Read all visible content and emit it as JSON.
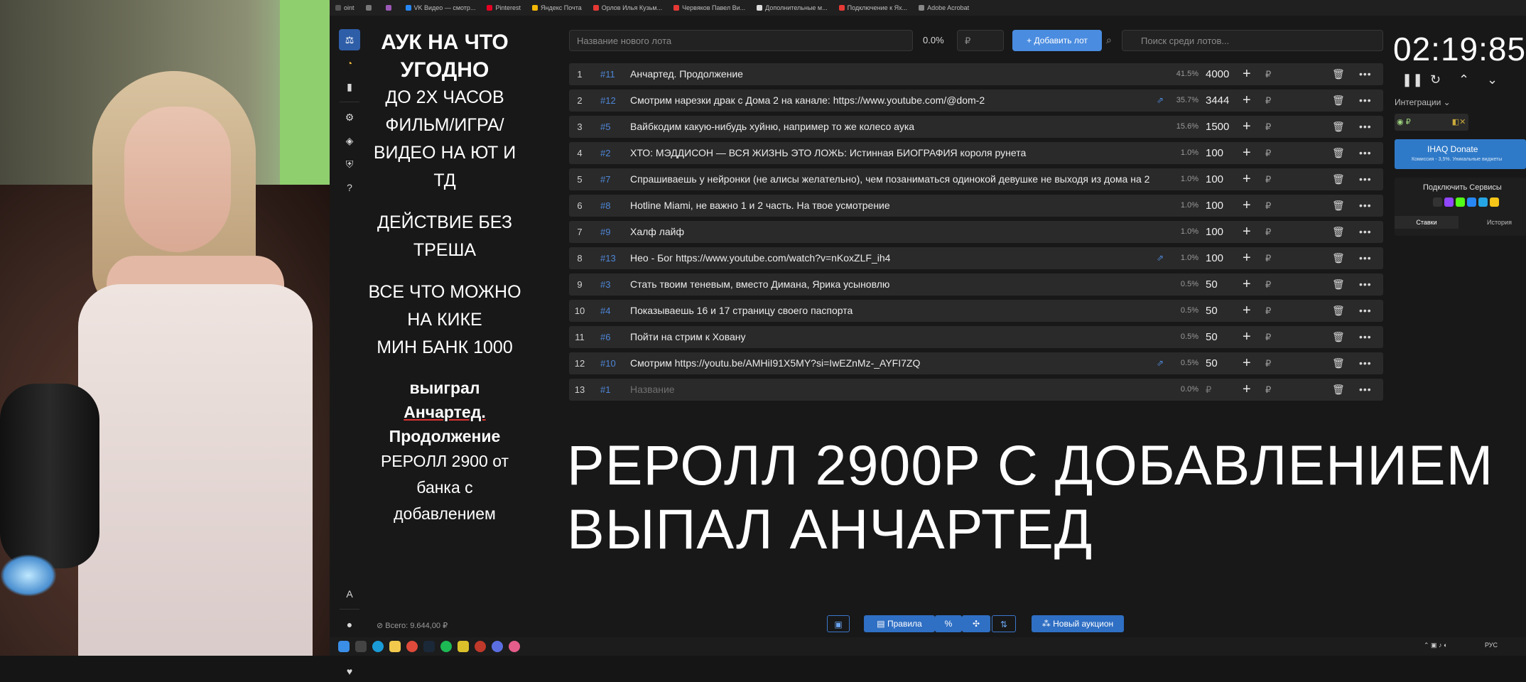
{
  "browser_tabs": [
    {
      "label": "oint",
      "color": "#555555"
    },
    {
      "label": "",
      "color": "#777777"
    },
    {
      "label": "",
      "color": "#9b59b6"
    },
    {
      "label": "VK Видео — смотр...",
      "color": "#2787f5"
    },
    {
      "label": "Pinterest",
      "color": "#e60023"
    },
    {
      "label": "Яндекс Почта",
      "color": "#f2b705"
    },
    {
      "label": "Орлов Илья Кузьм...",
      "color": "#e53935"
    },
    {
      "label": "Червяков Павел Ви...",
      "color": "#e53935"
    },
    {
      "label": "Дополнительные м...",
      "color": "#dddddd"
    },
    {
      "label": "Подключение к Ях...",
      "color": "#e53935"
    },
    {
      "label": "Adobe Acrobat",
      "color": "#888888"
    }
  ],
  "rules": {
    "title": "АУК НА ЧТО УГОДНО",
    "lines1": [
      "ДО 2Х ЧАСОВ",
      "ФИЛЬМ/ИГРА/",
      "ВИДЕО НА ЮТ И ТД"
    ],
    "lines2": [
      "ДЕЙСТВИЕ БЕЗ",
      "ТРЕША"
    ],
    "lines3": [
      "ВСЕ ЧТО МОЖНО",
      "НА КИКЕ",
      "МИН БАНК 1000"
    ],
    "winner_prefix": "выиграл ",
    "winner_name_1": "Анчартед.",
    "winner_name_2": "Продолжение",
    "reroll": [
      "РЕРОЛЛ 2900 от",
      "банка с",
      "добавлением"
    ]
  },
  "toolbar": {
    "new_lot_placeholder": "Название нового лота",
    "percent": "0.0%",
    "amount_placeholder": "₽",
    "add_label": "+ Добавить лот",
    "search_placeholder": "Поиск среди лотов..."
  },
  "lots": [
    {
      "n": "1",
      "id": "#11",
      "name": "Анчартед. Продолжение",
      "link": false,
      "pct": "41.5%",
      "amount": "4000"
    },
    {
      "n": "2",
      "id": "#12",
      "name": "Смотрим нарезки драк с Дома 2 на канале: https://www.youtube.com/@dom-2",
      "link": true,
      "pct": "35.7%",
      "amount": "3444"
    },
    {
      "n": "3",
      "id": "#5",
      "name": "Вайбкодим какую-нибудь хуйню, например то же колесо аука",
      "link": false,
      "pct": "15.6%",
      "amount": "1500"
    },
    {
      "n": "4",
      "id": "#2",
      "name": "ХТО: МЭДДИСОН — ВСЯ ЖИЗНЬ ЭТО ЛОЖЬ: Истинная БИОГРАФИЯ короля рунета",
      "link": false,
      "pct": "1.0%",
      "amount": "100"
    },
    {
      "n": "5",
      "id": "#7",
      "name": "Спрашиваешь у нейронки (не алисы желательно), чем позаниматься одинокой девушке не выходя из дома на 2",
      "link": false,
      "pct": "1.0%",
      "amount": "100"
    },
    {
      "n": "6",
      "id": "#8",
      "name": "Hotline Miami, не важно 1 и 2 часть. На твое усмотрение",
      "link": false,
      "pct": "1.0%",
      "amount": "100"
    },
    {
      "n": "7",
      "id": "#9",
      "name": "Халф лайф",
      "link": false,
      "pct": "1.0%",
      "amount": "100"
    },
    {
      "n": "8",
      "id": "#13",
      "name": "Нео - Бог https://www.youtube.com/watch?v=nKoxZLF_ih4",
      "link": true,
      "pct": "1.0%",
      "amount": "100"
    },
    {
      "n": "9",
      "id": "#3",
      "name": "Стать твоим теневым, вместо Димана, Ярика усыновлю",
      "link": false,
      "pct": "0.5%",
      "amount": "50"
    },
    {
      "n": "10",
      "id": "#4",
      "name": "Показываешь 16 и 17 страницу своего паспорта",
      "link": false,
      "pct": "0.5%",
      "amount": "50"
    },
    {
      "n": "11",
      "id": "#6",
      "name": "Пойти на стрим к Ховану",
      "link": false,
      "pct": "0.5%",
      "amount": "50"
    },
    {
      "n": "12",
      "id": "#10",
      "name": "Смотрим https://youtu.be/AMHiI91X5MY?si=IwEZnMz-_AYFI7ZQ",
      "link": true,
      "pct": "0.5%",
      "amount": "50"
    },
    {
      "n": "13",
      "id": "#1",
      "name": "Название",
      "link": false,
      "pct": "0.0%",
      "amount": "₽",
      "placeholder": true
    }
  ],
  "lot_currency": "₽",
  "overlay": {
    "line1": "РЕРОЛЛ 2900Р С ДОБАВЛЕНИЕМ",
    "line2": "ВЫПАЛ АНЧАРТЕД"
  },
  "footer": {
    "total": "Всего: 9.644,00 ₽",
    "rules_btn": "Правила",
    "new_auction": "Новый аукцион"
  },
  "right": {
    "timer": "02:19:85",
    "integrations": "Интеграции",
    "donate_title": "IHAQ Donate",
    "donate_sub": "Комиссия - 3,5%. Уникальные виджеты",
    "connect": "Подключить Сервисы",
    "tab_bids": "Ставки",
    "tab_history": "История"
  },
  "tray": {
    "lang": "РУС"
  }
}
